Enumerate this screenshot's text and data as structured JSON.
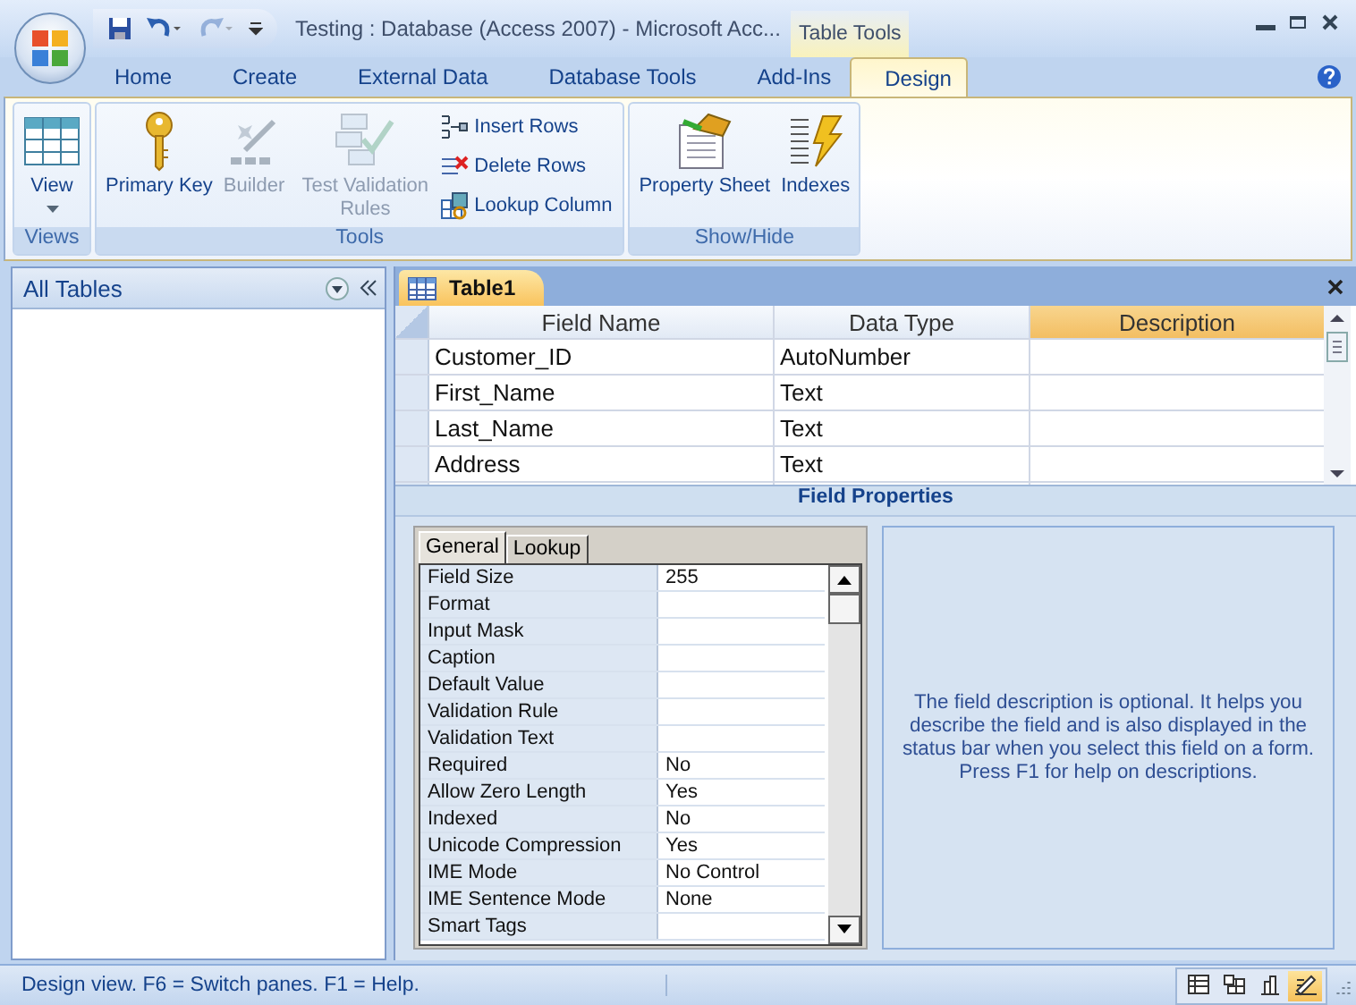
{
  "window": {
    "title": "Testing : Database (Access 2007) - Microsoft Acc...",
    "contextual_tab": "Table Tools"
  },
  "tabs": [
    {
      "label": "Home",
      "selected": false
    },
    {
      "label": "Create",
      "selected": false
    },
    {
      "label": "External Data",
      "selected": false
    },
    {
      "label": "Database Tools",
      "selected": false
    },
    {
      "label": "Add-Ins",
      "selected": false
    },
    {
      "label": "Design",
      "selected": true
    }
  ],
  "ribbon_groups": [
    {
      "label": "Views",
      "buttons": [
        {
          "kind": "large",
          "label": "View",
          "dropdown": true,
          "disabled": false
        }
      ]
    },
    {
      "label": "Tools",
      "buttons": [
        {
          "kind": "large",
          "label": "Primary Key",
          "disabled": false
        },
        {
          "kind": "large",
          "label": "Builder",
          "disabled": true
        },
        {
          "kind": "large",
          "label": "Test Validation Rules",
          "disabled": true
        },
        {
          "kind": "small",
          "label": "Insert Rows",
          "disabled": false
        },
        {
          "kind": "small",
          "label": "Delete Rows",
          "disabled": false
        },
        {
          "kind": "small",
          "label": "Lookup Column",
          "disabled": false
        }
      ]
    },
    {
      "label": "Show/Hide",
      "buttons": [
        {
          "kind": "large",
          "label": "Property Sheet",
          "disabled": false
        },
        {
          "kind": "large",
          "label": "Indexes",
          "disabled": false
        }
      ]
    }
  ],
  "nav_pane": {
    "title": "All Tables"
  },
  "document": {
    "tab": "Table1",
    "columns": [
      {
        "label": "Field Name",
        "selected": false
      },
      {
        "label": "Data Type",
        "selected": false
      },
      {
        "label": "Description",
        "selected": true
      }
    ],
    "rows": [
      [
        "Customer_ID",
        "AutoNumber",
        ""
      ],
      [
        "First_Name",
        "Text",
        ""
      ],
      [
        "Last_Name",
        "Text",
        ""
      ],
      [
        "Address",
        "Text",
        ""
      ]
    ]
  },
  "field_properties": {
    "title": "Field Properties",
    "tabs": [
      {
        "label": "General",
        "selected": true
      },
      {
        "label": "Lookup",
        "selected": false
      }
    ],
    "rows": [
      {
        "name": "Field Size",
        "value": "255"
      },
      {
        "name": "Format",
        "value": ""
      },
      {
        "name": "Input Mask",
        "value": ""
      },
      {
        "name": "Caption",
        "value": ""
      },
      {
        "name": "Default Value",
        "value": ""
      },
      {
        "name": "Validation Rule",
        "value": ""
      },
      {
        "name": "Validation Text",
        "value": ""
      },
      {
        "name": "Required",
        "value": "No"
      },
      {
        "name": "Allow Zero Length",
        "value": "Yes"
      },
      {
        "name": "Indexed",
        "value": "No"
      },
      {
        "name": "Unicode Compression",
        "value": "Yes"
      },
      {
        "name": "IME Mode",
        "value": "No Control"
      },
      {
        "name": "IME Sentence Mode",
        "value": "None"
      },
      {
        "name": "Smart Tags",
        "value": ""
      }
    ],
    "help": "The field description is optional.  It helps you describe the field and is also displayed in the status bar when you select this field on a form.  Press F1 for help on descriptions."
  },
  "status_bar": {
    "text": "Design view.  F6 = Switch panes.  F1 = Help.",
    "views": [
      {
        "selected": false
      },
      {
        "selected": false
      },
      {
        "selected": false
      },
      {
        "selected": true
      }
    ]
  }
}
